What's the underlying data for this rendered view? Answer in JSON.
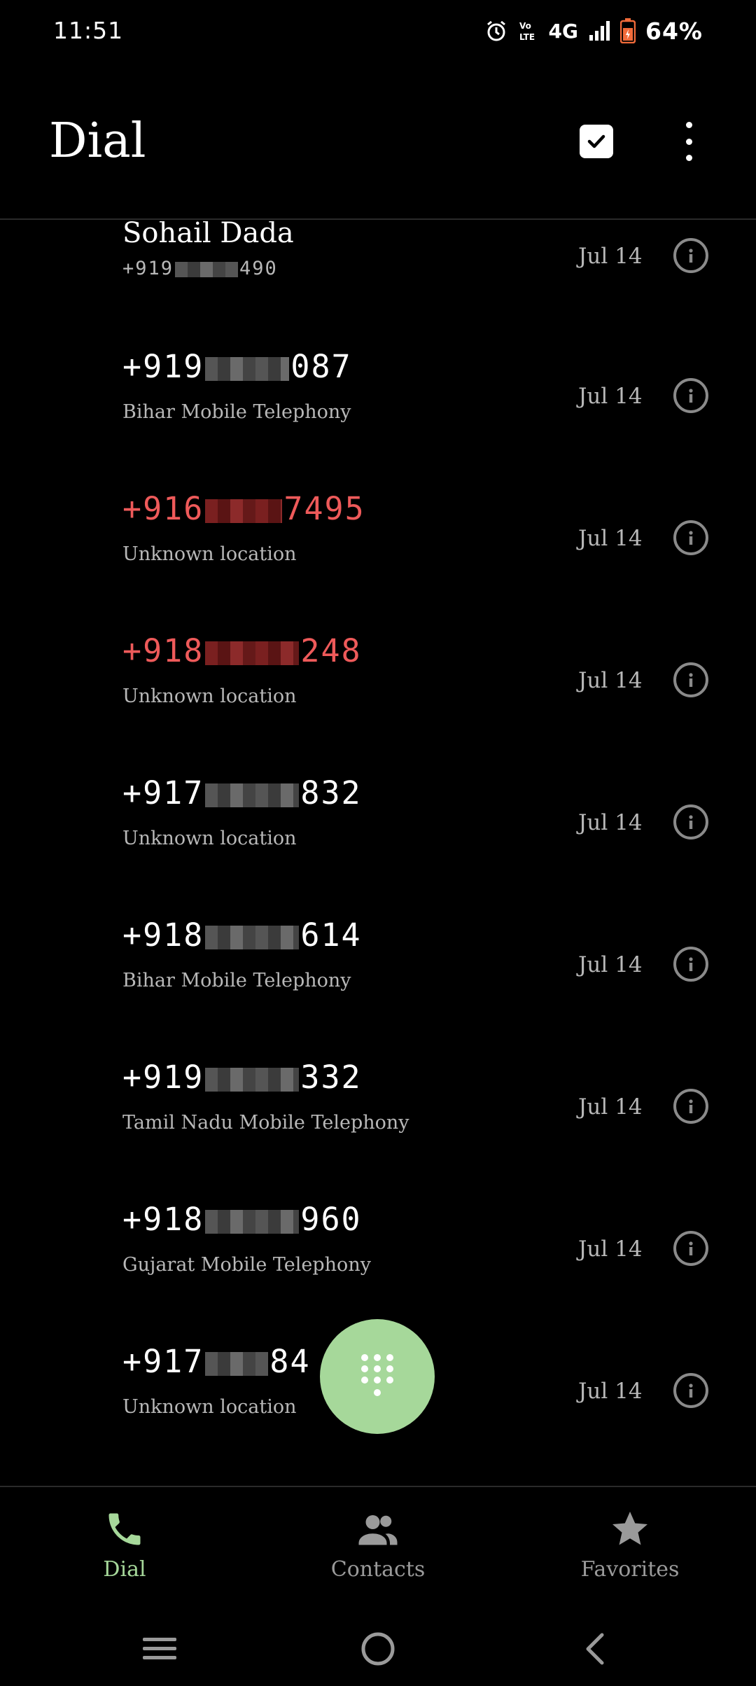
{
  "status_bar": {
    "time": "11:51",
    "network": "4G",
    "battery": "64%"
  },
  "app_bar": {
    "title": "Dial"
  },
  "call_log": [
    {
      "name": "Sohail Dada",
      "number_prefix": "+919",
      "number_suffix": "490",
      "date": "Jul 14",
      "missed": false
    },
    {
      "number_prefix": "+919",
      "number_suffix": "087",
      "location": "Bihar Mobile Telephony",
      "date": "Jul 14",
      "missed": false
    },
    {
      "number_prefix": "+916",
      "number_suffix": "7495",
      "location": "Unknown location",
      "date": "Jul 14",
      "missed": true
    },
    {
      "number_prefix": "+918",
      "number_suffix": "248",
      "location": "Unknown location",
      "date": "Jul 14",
      "missed": true
    },
    {
      "number_prefix": "+917",
      "number_suffix": "832",
      "location": "Unknown location",
      "date": "Jul 14",
      "missed": false
    },
    {
      "number_prefix": "+918",
      "number_suffix": "614",
      "location": "Bihar Mobile Telephony",
      "date": "Jul 14",
      "missed": false
    },
    {
      "number_prefix": "+919",
      "number_suffix": "332",
      "location": "Tamil Nadu Mobile Telephony",
      "date": "Jul 14",
      "missed": false
    },
    {
      "number_prefix": "+918",
      "number_suffix": "960",
      "location": "Gujarat Mobile Telephony",
      "date": "Jul 14",
      "missed": false
    },
    {
      "number_prefix": "+917",
      "number_suffix": "84",
      "location": "Unknown location",
      "date": "Jul 14",
      "missed": false
    }
  ],
  "bottom_nav": {
    "items": [
      {
        "label": "Dial",
        "icon": "phone-icon",
        "active": true
      },
      {
        "label": "Contacts",
        "icon": "contacts-icon",
        "active": false
      },
      {
        "label": "Favorites",
        "icon": "star-icon",
        "active": false
      }
    ]
  },
  "colors": {
    "accent": "#a6d89a",
    "missed": "#ee5a5a",
    "background": "#000000"
  }
}
